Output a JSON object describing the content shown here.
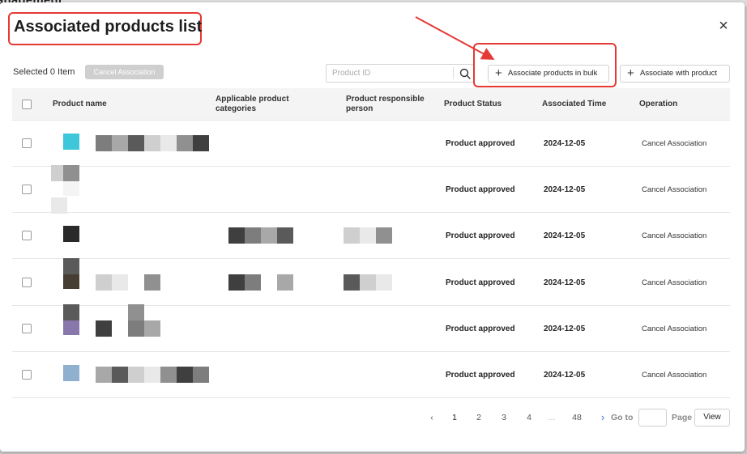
{
  "background": {
    "title": "anagement"
  },
  "dialog": {
    "title": "Associated products list",
    "close_label": "×"
  },
  "toolbar": {
    "selected_text": "Selected 0 Item",
    "cancel_association_label": "Cancel Association",
    "search_placeholder": "Product ID",
    "bulk_label": "Associate products in bulk",
    "associate_label": "Associate with product"
  },
  "table": {
    "headers": {
      "name": "Product name",
      "categories": "Applicable product categories",
      "responsible": "Product responsible person",
      "status": "Product Status",
      "time": "Associated Time",
      "operation": "Operation"
    },
    "rows": [
      {
        "status": "Product approved",
        "time": "2024-12-05",
        "operation": "Cancel Association",
        "thumb_color": "#3ec7db"
      },
      {
        "status": "Product approved",
        "time": "2024-12-05",
        "operation": "Cancel Association",
        "thumb_color": "#f4f4f4"
      },
      {
        "status": "Product approved",
        "time": "2024-12-05",
        "operation": "Cancel Association",
        "thumb_color": "#2a2a2a"
      },
      {
        "status": "Product approved",
        "time": "2024-12-05",
        "operation": "Cancel Association",
        "thumb_color": "#463d33"
      },
      {
        "status": "Product approved",
        "time": "2024-12-05",
        "operation": "Cancel Association",
        "thumb_color": "#8877aa"
      },
      {
        "status": "Product approved",
        "time": "2024-12-05",
        "operation": "Cancel Association",
        "thumb_color": "#8fb0cf"
      }
    ]
  },
  "pagination": {
    "prev": "‹",
    "pages": [
      "1",
      "2",
      "3",
      "4",
      "...",
      "48"
    ],
    "next": "›",
    "goto_label": "Go to",
    "page_label": "Page",
    "view_label": "View"
  },
  "colors": {
    "annotation_red": "#e53935",
    "link_blue": "#3c6fd6"
  }
}
